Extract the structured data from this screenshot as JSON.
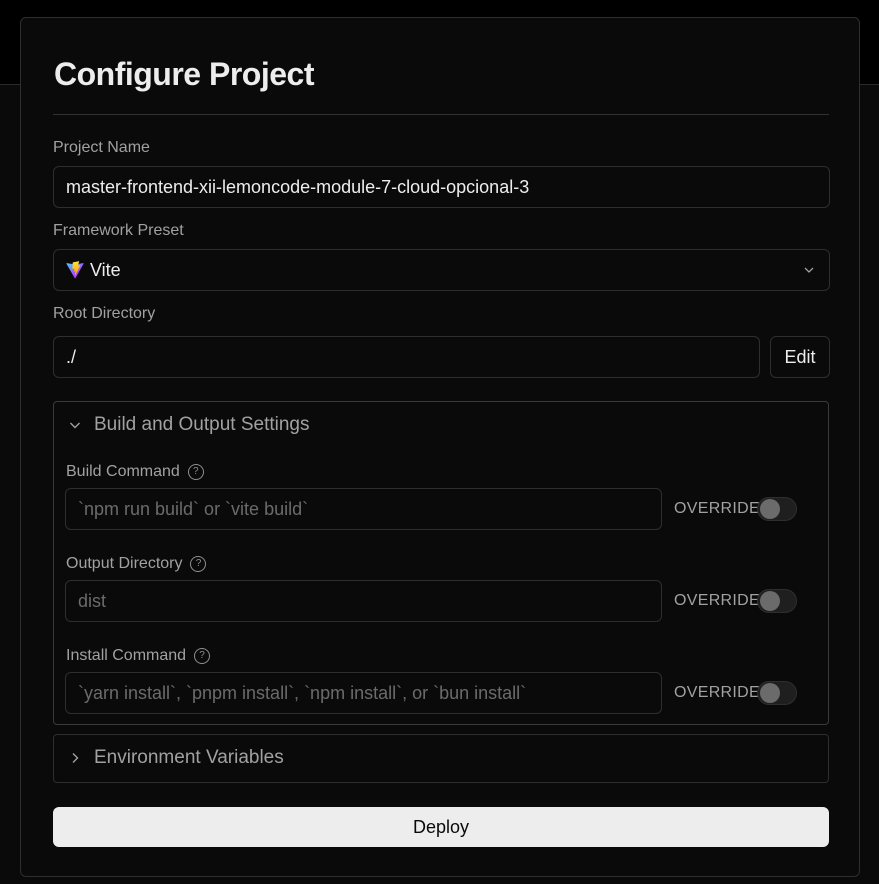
{
  "dialog": {
    "title": "Configure Project"
  },
  "project_name": {
    "label": "Project Name",
    "value": "master-frontend-xii-lemoncode-module-7-cloud-opcional-3"
  },
  "framework_preset": {
    "label": "Framework Preset",
    "selected": "Vite",
    "icon": "vite-logo-icon"
  },
  "root_directory": {
    "label": "Root Directory",
    "value": "./",
    "edit_label": "Edit"
  },
  "build_settings": {
    "title": "Build and Output Settings",
    "help_glyph": "?",
    "override_label": "OVERRIDE",
    "build_command": {
      "label": "Build Command",
      "placeholder": "`npm run build` or `vite build`"
    },
    "output_directory": {
      "label": "Output Directory",
      "placeholder": "dist"
    },
    "install_command": {
      "label": "Install Command",
      "placeholder": "`yarn install`, `pnpm install`, `npm install`, or `bun install`"
    }
  },
  "env_vars": {
    "title": "Environment Variables"
  },
  "deploy": {
    "label": "Deploy"
  },
  "colors": {
    "background": "#000000",
    "card": "#0a0a0a",
    "border": "#2e2e2e",
    "text": "#ededed",
    "muted": "#a1a1a1",
    "button_bg": "#ededed"
  }
}
